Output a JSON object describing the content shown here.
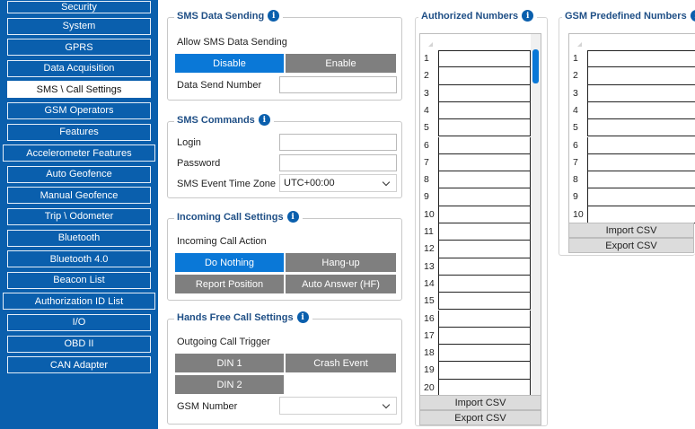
{
  "sidebar": {
    "items": [
      {
        "label": "Security"
      },
      {
        "label": "System"
      },
      {
        "label": "GPRS"
      },
      {
        "label": "Data Acquisition"
      },
      {
        "label": "SMS \\ Call Settings",
        "active": true
      },
      {
        "label": "GSM Operators"
      },
      {
        "label": "Features"
      },
      {
        "label": "Accelerometer Features"
      },
      {
        "label": "Auto Geofence"
      },
      {
        "label": "Manual Geofence"
      },
      {
        "label": "Trip \\ Odometer"
      },
      {
        "label": "Bluetooth"
      },
      {
        "label": "Bluetooth 4.0"
      },
      {
        "label": "Beacon List"
      },
      {
        "label": "Authorization ID List"
      },
      {
        "label": "I/O"
      },
      {
        "label": "OBD II"
      },
      {
        "label": "CAN Adapter"
      }
    ]
  },
  "sms_data_sending": {
    "title": "SMS Data Sending",
    "allow_label": "Allow SMS Data Sending",
    "disable": "Disable",
    "enable": "Enable",
    "send_number_label": "Data Send Number",
    "send_number_value": ""
  },
  "sms_commands": {
    "title": "SMS Commands",
    "login_label": "Login",
    "login_value": "",
    "password_label": "Password",
    "password_value": "",
    "timezone_label": "SMS Event Time Zone",
    "timezone_value": "UTC+00:00"
  },
  "incoming_call": {
    "title": "Incoming Call Settings",
    "action_label": "Incoming Call Action",
    "do_nothing": "Do Nothing",
    "hang_up": "Hang-up",
    "report_position": "Report Position",
    "auto_answer": "Auto Answer (HF)"
  },
  "hands_free": {
    "title": "Hands Free Call Settings",
    "trigger_label": "Outgoing Call Trigger",
    "din1": "DIN 1",
    "crash_event": "Crash Event",
    "din2": "DIN 2",
    "gsm_label": "GSM Number",
    "gsm_value": ""
  },
  "authorized": {
    "title": "Authorized Numbers",
    "rows": [
      "1",
      "2",
      "3",
      "4",
      "5",
      "6",
      "7",
      "8",
      "9",
      "10",
      "11",
      "12",
      "13",
      "14",
      "15",
      "16",
      "17",
      "18",
      "19",
      "20"
    ],
    "import": "Import CSV",
    "export": "Export CSV"
  },
  "gsm_predefined": {
    "title": "GSM Predefined Numbers",
    "rows": [
      "1",
      "2",
      "3",
      "4",
      "5",
      "6",
      "7",
      "8",
      "9",
      "10"
    ],
    "import": "Import CSV",
    "export": "Export CSV"
  },
  "colors": {
    "sidebar_bg": "#0a5fad",
    "active_button": "#0a78d7",
    "inactive_button": "#7f7f7f",
    "title_text": "#1f4f86"
  }
}
